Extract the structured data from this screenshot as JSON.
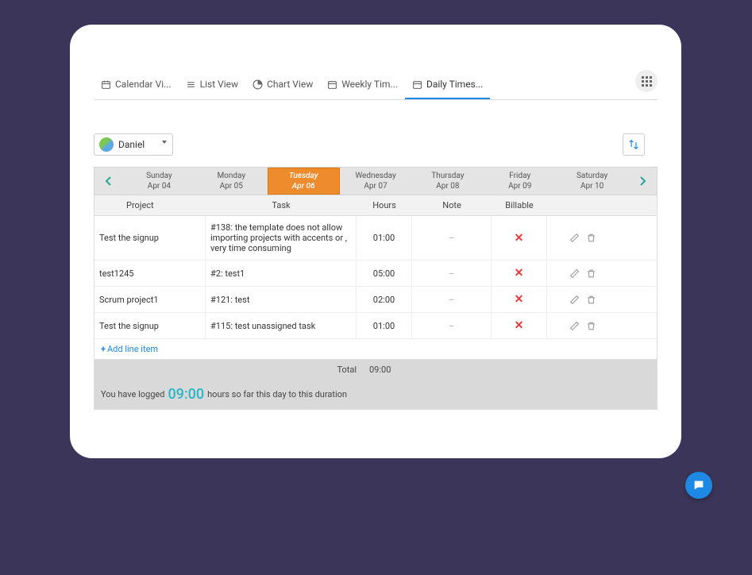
{
  "tabs": {
    "calendar": "Calendar Vi...",
    "list": "List View",
    "chart": "Chart View",
    "weekly": "Weekly Tim...",
    "daily": "Daily Times..."
  },
  "user": {
    "name": "Daniel"
  },
  "days": [
    {
      "weekday": "Sunday",
      "date": "Apr 04"
    },
    {
      "weekday": "Monday",
      "date": "Apr 05"
    },
    {
      "weekday": "Tuesday",
      "date": "Apr 06"
    },
    {
      "weekday": "Wednesday",
      "date": "Apr 07"
    },
    {
      "weekday": "Thursday",
      "date": "Apr 08"
    },
    {
      "weekday": "Friday",
      "date": "Apr 09"
    },
    {
      "weekday": "Saturday",
      "date": "Apr 10"
    }
  ],
  "active_day_index": 2,
  "columns": {
    "project": "Project",
    "task": "Task",
    "hours": "Hours",
    "note": "Note",
    "billable": "Billable"
  },
  "rows": [
    {
      "project": "Test the signup",
      "task": "#138: the template does not allow importing projects with accents or , very time consuming",
      "hours": "01:00",
      "note": "--",
      "billable": false
    },
    {
      "project": "test1245",
      "task": "#2: test1",
      "hours": "05:00",
      "note": "--",
      "billable": false
    },
    {
      "project": "Scrum project1",
      "task": "#121: test",
      "hours": "02:00",
      "note": "--",
      "billable": false
    },
    {
      "project": "Test the signup",
      "task": "#115: test unassigned task",
      "hours": "01:00",
      "note": "--",
      "billable": false
    }
  ],
  "add_line_label": "Add line item",
  "total": {
    "label": "Total",
    "value": "09:00"
  },
  "logged": {
    "prefix": "You have logged",
    "value": "09:00",
    "suffix": "hours so far this day to this duration"
  }
}
